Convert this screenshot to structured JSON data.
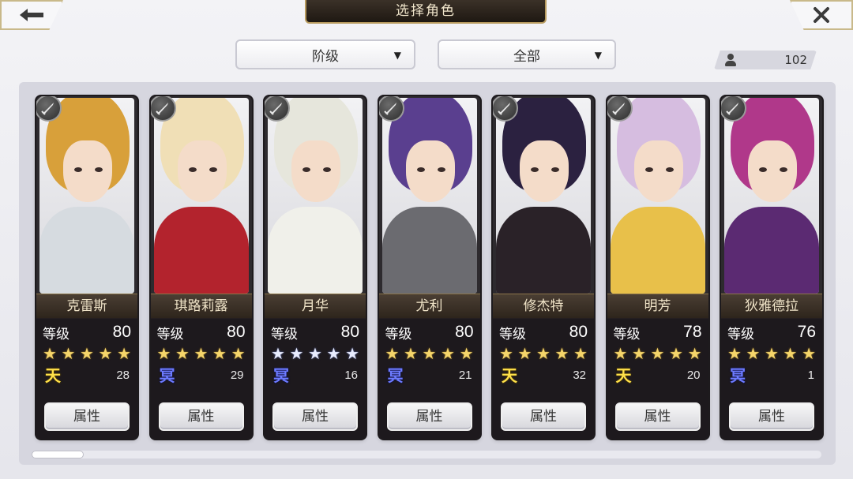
{
  "header": {
    "title": "选择角色"
  },
  "filters": {
    "rank_label": "阶级",
    "scope_label": "全部"
  },
  "roster_count": "102",
  "card_common": {
    "level_label": "等级",
    "attr_label": "属性"
  },
  "characters": [
    {
      "name": "克雷斯",
      "level": "80",
      "stars": 5,
      "star_color": "gold",
      "rank": "天",
      "rank_color": "gold",
      "quantity": "28",
      "hair": "#d8a03a",
      "outfit": "#d6dbe0"
    },
    {
      "name": "琪路莉露",
      "level": "80",
      "stars": 5,
      "star_color": "gold",
      "rank": "冥",
      "rank_color": "blue",
      "quantity": "29",
      "hair": "#f0dfb6",
      "outfit": "#b3232d"
    },
    {
      "name": "月华",
      "level": "80",
      "stars": 5,
      "star_color": "silver",
      "rank": "冥",
      "rank_color": "blue",
      "quantity": "16",
      "hair": "#e6e6dc",
      "outfit": "#f0f0ea"
    },
    {
      "name": "尤利",
      "level": "80",
      "stars": 5,
      "star_color": "gold",
      "rank": "冥",
      "rank_color": "blue",
      "quantity": "21",
      "hair": "#5a3f8f",
      "outfit": "#6b6b70"
    },
    {
      "name": "修杰特",
      "level": "80",
      "stars": 5,
      "star_color": "gold",
      "rank": "天",
      "rank_color": "gold",
      "quantity": "32",
      "hair": "#2b2140",
      "outfit": "#2a2228"
    },
    {
      "name": "明芳",
      "level": "78",
      "stars": 5,
      "star_color": "gold",
      "rank": "天",
      "rank_color": "gold",
      "quantity": "20",
      "hair": "#d6bde0",
      "outfit": "#e8c04a"
    },
    {
      "name": "狄雅德拉",
      "level": "76",
      "stars": 5,
      "star_color": "gold",
      "rank": "冥",
      "rank_color": "blue",
      "quantity": "1",
      "hair": "#b0388a",
      "outfit": "#5b2a72"
    }
  ]
}
